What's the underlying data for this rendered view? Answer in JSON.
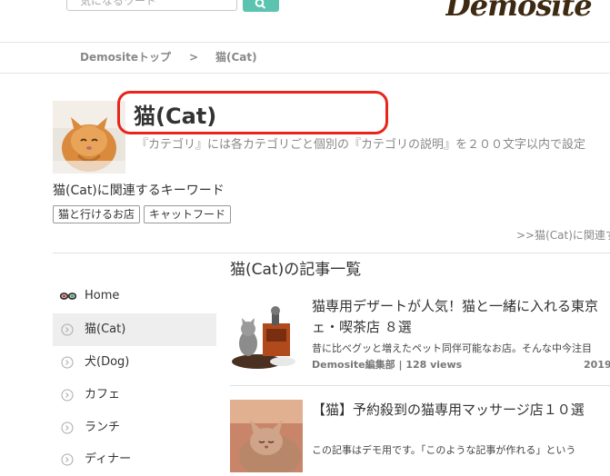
{
  "header": {
    "search_placeholder": "気になるワード",
    "logo_text": "Demosite"
  },
  "breadcrumb": {
    "home": "Demositeトップ",
    "separator": ">",
    "current": "猫(Cat)"
  },
  "category": {
    "title": "猫(Cat)",
    "description": "『カテゴリ』には各カテゴリごと個別の『カテゴリの説明』を２００文字以内で設定",
    "keywords_heading": "猫(Cat)に関連するキーワード",
    "tags": [
      "猫と行けるお店",
      "キャットフード"
    ],
    "more_link": ">>猫(Cat)に関連す"
  },
  "sidebar": {
    "items": [
      {
        "label": "Home",
        "icon": "glasses-icon"
      },
      {
        "label": "猫(Cat)",
        "icon": "circle-arrow-icon"
      },
      {
        "label": "犬(Dog)",
        "icon": "circle-arrow-icon"
      },
      {
        "label": "カフェ",
        "icon": "circle-arrow-icon"
      },
      {
        "label": "ランチ",
        "icon": "circle-arrow-icon"
      },
      {
        "label": "ディナー",
        "icon": "circle-arrow-icon"
      }
    ]
  },
  "articles": {
    "heading": "猫(Cat)の記事一覧",
    "items": [
      {
        "title_line1": "猫専用デザートが人気！猫と一緒に入れる東京",
        "title_line2": "ェ・喫茶店 ８選",
        "excerpt": "昔に比べグッと増えたペット同伴可能なお店。そんな中今注目",
        "meta": "Demosite編集部 | 128 views",
        "date": "2019"
      },
      {
        "title_line1": "【猫】予約殺到の猫専用マッサージ店１０選",
        "excerpt": "この記事はデモ用です。「このような記事が作れる」という"
      }
    ]
  },
  "colors": {
    "accent": "#5bc3b0",
    "highlight": "#e8241b",
    "logo": "#3e2a12"
  }
}
